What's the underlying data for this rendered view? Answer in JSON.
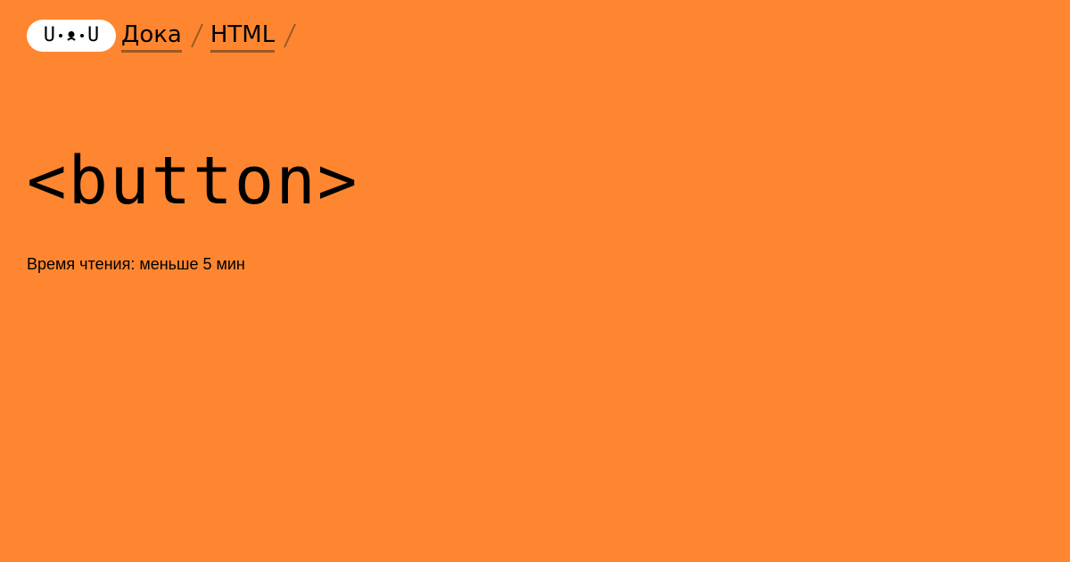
{
  "header": {
    "logo": {
      "left_letter": "U",
      "right_letter": "U",
      "icon": "doka-face-logo-icon"
    },
    "breadcrumb": [
      {
        "label": "Дока"
      },
      {
        "label": "HTML"
      }
    ],
    "separator_icon": "slash-separator-icon"
  },
  "main": {
    "title": "<button>",
    "reading_time": "Время чтения: меньше 5 мин"
  },
  "colors": {
    "background": "#ff8630",
    "link_underline": "#9a5a22",
    "logo_background": "#ffffff",
    "text": "#000000"
  }
}
